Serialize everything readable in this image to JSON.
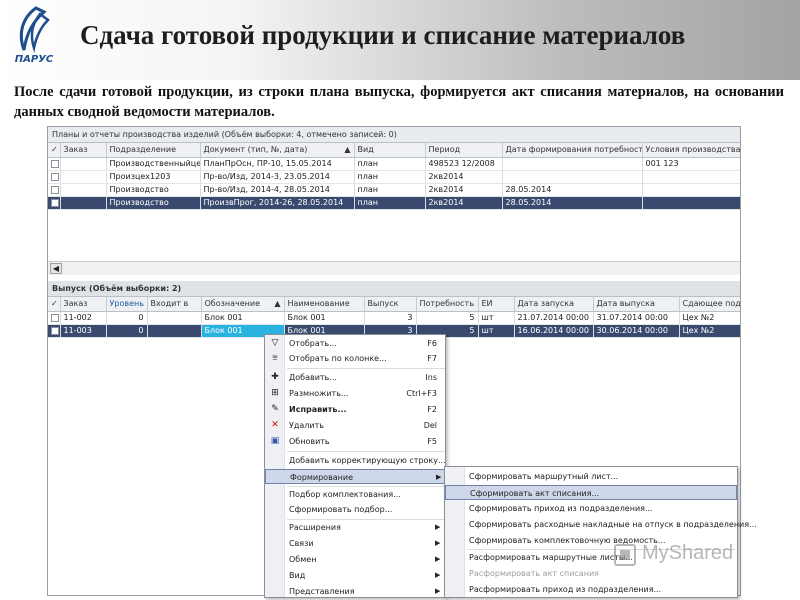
{
  "slide": {
    "logo_text": "ПАРУС",
    "title": "Сдача готовой продукции и списание материалов",
    "text": "После сдачи готовой продукции, из строки плана выпуска, формируется акт списания материалов, на основании данных сводной ведомости материалов."
  },
  "plans_panel": {
    "title": "Планы и отчеты производства изделий (Объём выборки: 4, отмечено записей: 0)",
    "columns": [
      "✓",
      "Заказ",
      "Подразделение",
      "Документ (тип, №, дата)",
      "Вид",
      "Период",
      "Дата формирования потребности/ра",
      "Условия производства"
    ],
    "rows": [
      [
        "",
        "",
        "Производственныйцех",
        "ПланПрОсн, ПР-10, 15.05.2014",
        "план",
        "498523 12/2008",
        "",
        "001 123"
      ],
      [
        "",
        "",
        "Произцех1203",
        "Пр-во/Изд, 2014-3, 23.05.2014",
        "план",
        "2кв2014",
        "",
        ""
      ],
      [
        "",
        "",
        "Производство",
        "Пр-во/Изд, 2014-4, 28.05.2014",
        "план",
        "2кв2014",
        "28.05.2014",
        ""
      ],
      [
        "",
        "",
        "Производство",
        "ПроизвПрог, 2014-26, 28.05.2014",
        "план",
        "2кв2014",
        "28.05.2014",
        ""
      ]
    ],
    "selected_row": 3
  },
  "release_panel": {
    "title": "Выпуск (Объём выборки: 2)",
    "columns": [
      "✓",
      "Заказ",
      "Уровень в",
      "Входит в",
      "Обозначение",
      "Наименование",
      "Выпуск",
      "Потребность",
      "ЕИ",
      "Дата запуска",
      "Дата выпуска",
      "Сдающее под"
    ],
    "rows": [
      [
        "",
        "11-002",
        "0",
        "",
        "Блок 001",
        "Блок 001",
        "3",
        "5",
        "шт",
        "21.07.2014 00:00",
        "31.07.2014 00:00",
        "Цех №2"
      ],
      [
        "",
        "11-003",
        "0",
        "",
        "Блок 001",
        "Блок 001",
        "3",
        "5",
        "шт",
        "16.06.2014 00:00",
        "30.06.2014 00:00",
        "Цех №2"
      ]
    ],
    "selected_row": 1
  },
  "context_menu": {
    "items": [
      {
        "icon": "funnel",
        "label": "Отобрать...",
        "shortcut": "F6"
      },
      {
        "icon": "funnel-column",
        "label": "Отобрать по колонке...",
        "shortcut": "F7"
      },
      {
        "icon": "plus",
        "label": "Добавить...",
        "shortcut": "Ins"
      },
      {
        "icon": "multiply",
        "label": "Размножить...",
        "shortcut": "Ctrl+F3"
      },
      {
        "icon": "edit",
        "label": "Исправить...",
        "shortcut": "F2"
      },
      {
        "icon": "delete",
        "label": "Удалить",
        "shortcut": "Del"
      },
      {
        "icon": "refresh",
        "label": "Обновить",
        "shortcut": "F5"
      },
      {
        "label": "Добавить корректирующую строку..."
      },
      {
        "label": "Формирование"
      },
      {
        "label": "Подбор комплектования..."
      },
      {
        "label": "Сформировать подбор..."
      },
      {
        "label": "Расширения"
      },
      {
        "label": "Связи"
      },
      {
        "label": "Обмен"
      },
      {
        "label": "Вид"
      },
      {
        "label": "Представления"
      }
    ]
  },
  "submenu": {
    "items": [
      "Сформировать маршрутный лист...",
      "Сформировать акт списания...",
      "Сформировать приход из подразделения...",
      "Сформировать расходные накладные на отпуск в подразделения...",
      "Сформировать комплектовочную ведомость...",
      "Расформировать маршрутные листы...",
      "Расформировать акт списания",
      "Расформировать приход из подразделения..."
    ]
  },
  "watermark": {
    "text": "MyShared"
  },
  "colors": {
    "selection": "#3a4a6e",
    "highlight_cell": "#2bb3e0",
    "logo": "#1f4e8f"
  }
}
